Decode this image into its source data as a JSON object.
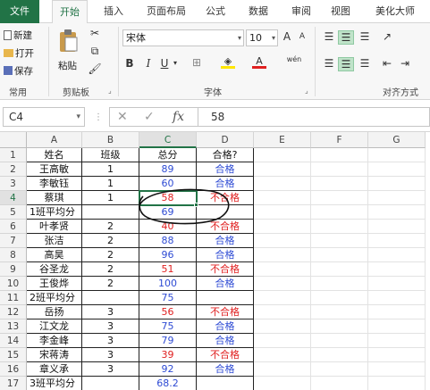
{
  "tabs": [
    {
      "label": "文件",
      "key": "file"
    },
    {
      "label": "开始",
      "key": "home"
    },
    {
      "label": "插入",
      "key": "insert"
    },
    {
      "label": "页面布局",
      "key": "layout"
    },
    {
      "label": "公式",
      "key": "formulas"
    },
    {
      "label": "数据",
      "key": "data"
    },
    {
      "label": "审阅",
      "key": "review"
    },
    {
      "label": "视图",
      "key": "view"
    },
    {
      "label": "美化大师",
      "key": "beautify"
    }
  ],
  "ribbon": {
    "new_label": "新建",
    "open_label": "打开",
    "save_label": "保存",
    "paste_label": "粘贴",
    "group_common": "常用",
    "group_clipboard": "剪贴板",
    "group_font": "字体",
    "group_align": "对齐方式",
    "font_name": "宋体",
    "font_size": "10",
    "bold": "B",
    "italic": "I",
    "underline": "U",
    "grow_font": "A",
    "shrink_font": "A",
    "font_color_letter": "A",
    "phonetic": "wén"
  },
  "formula_bar": {
    "name_box": "C4",
    "cancel_glyph": "✕",
    "enter_glyph": "✓",
    "fx_label": "fx",
    "value": "58"
  },
  "columns": [
    "A",
    "B",
    "C",
    "D",
    "E",
    "F",
    "G"
  ],
  "rows": [
    "1",
    "2",
    "3",
    "4",
    "5",
    "6",
    "7",
    "8",
    "9",
    "10",
    "11",
    "12",
    "13",
    "14",
    "15",
    "16",
    "17"
  ],
  "table": [
    {
      "name": "姓名",
      "cls": "班级",
      "score": "总分",
      "pass": "合格?"
    },
    {
      "name": "王高敏",
      "cls": "1",
      "score": "89",
      "pass": "合格"
    },
    {
      "name": "李敏钰",
      "cls": "1",
      "score": "60",
      "pass": "合格"
    },
    {
      "name": "蔡琪",
      "cls": "1",
      "score": "58",
      "pass": "不合格"
    },
    {
      "name": "1班平均分",
      "cls": "",
      "score": "69",
      "pass": ""
    },
    {
      "name": "叶孝贤",
      "cls": "2",
      "score": "40",
      "pass": "不合格"
    },
    {
      "name": "张洁",
      "cls": "2",
      "score": "88",
      "pass": "合格"
    },
    {
      "name": "高昊",
      "cls": "2",
      "score": "96",
      "pass": "合格"
    },
    {
      "name": "谷圣龙",
      "cls": "2",
      "score": "51",
      "pass": "不合格"
    },
    {
      "name": "王俊烨",
      "cls": "2",
      "score": "100",
      "pass": "合格"
    },
    {
      "name": "2班平均分",
      "cls": "",
      "score": "75",
      "pass": ""
    },
    {
      "name": "岳扬",
      "cls": "3",
      "score": "56",
      "pass": "不合格"
    },
    {
      "name": "江文龙",
      "cls": "3",
      "score": "75",
      "pass": "合格"
    },
    {
      "name": "李金峰",
      "cls": "3",
      "score": "79",
      "pass": "合格"
    },
    {
      "name": "宋蒋涛",
      "cls": "3",
      "score": "39",
      "pass": "不合格"
    },
    {
      "name": "章义承",
      "cls": "3",
      "score": "92",
      "pass": "合格"
    },
    {
      "name": "3班平均分",
      "cls": "",
      "score": "68.2",
      "pass": ""
    }
  ],
  "colors": {
    "accent": "#217346",
    "pass": "#2e4bd4",
    "fail": "#e02020"
  },
  "selected_cell": "C4"
}
